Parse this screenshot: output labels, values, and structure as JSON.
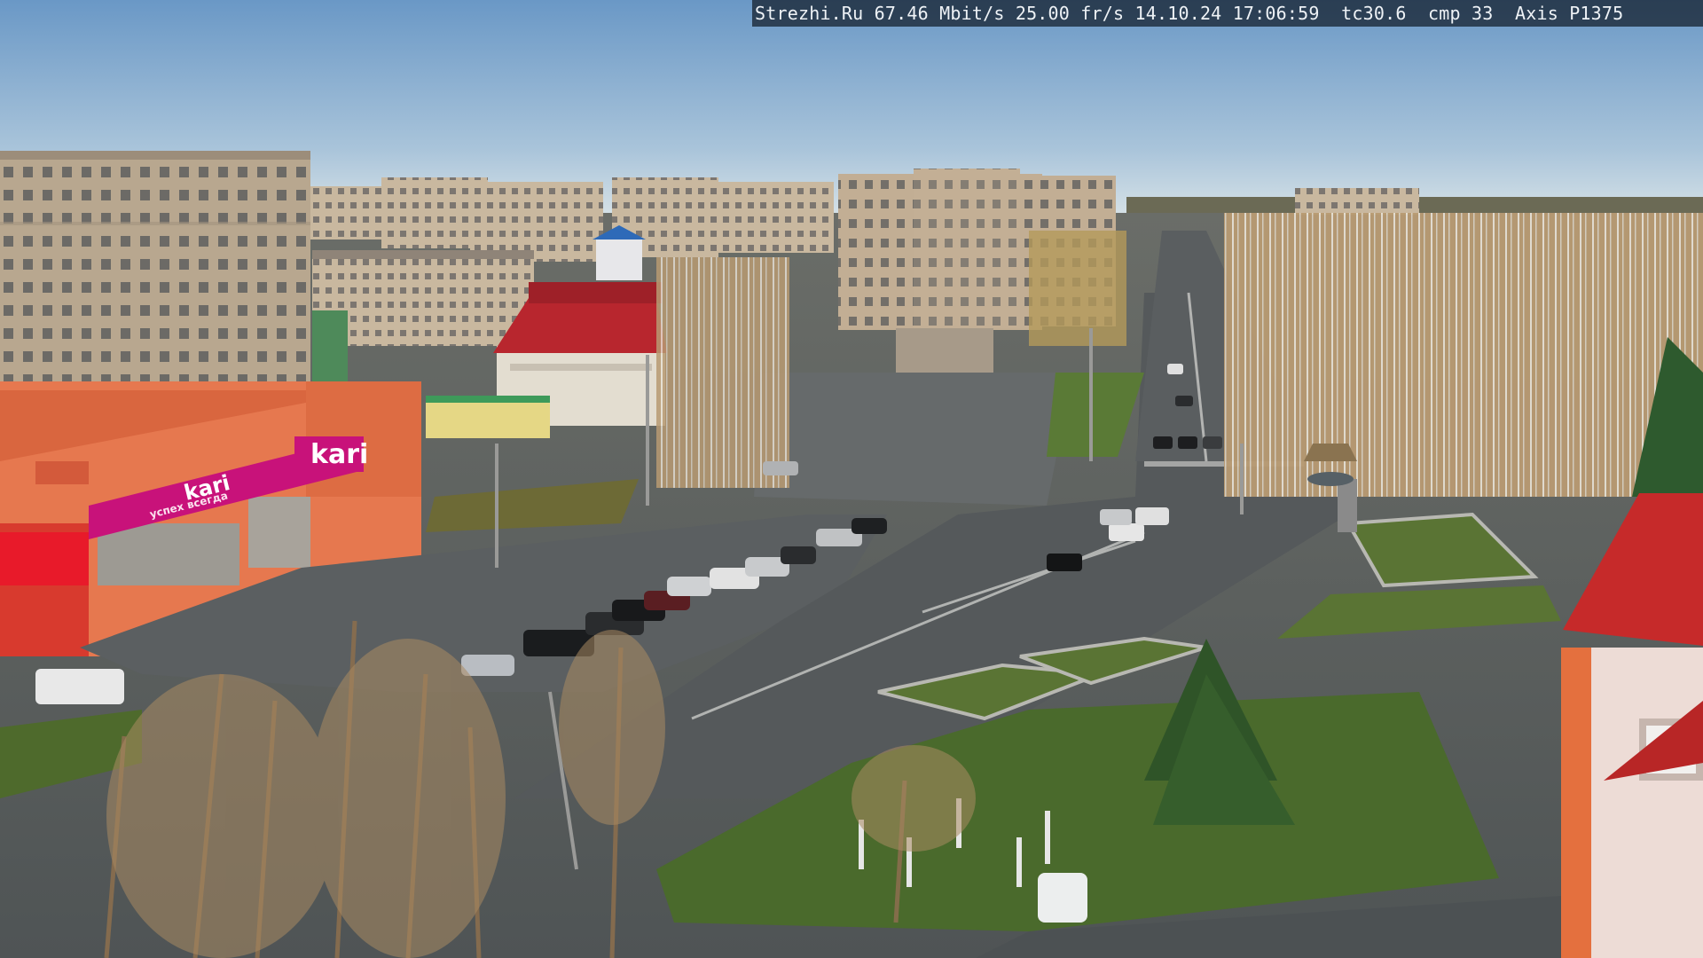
{
  "camera_overlay": {
    "site": "Strezhi.Ru",
    "bitrate": "67.46 Mbit/s",
    "framerate": "25.00 fr/s",
    "date": "14.10.24",
    "time": "17:06:59",
    "tc": "tc30.6",
    "cmp": "cmp 33",
    "camera_model": "Axis P1375"
  },
  "store_signs": {
    "brand": "kari",
    "banner_brand": "kari",
    "banner_tagline": "успех всегда"
  },
  "colors": {
    "sky_top": "#6f9cc9",
    "sky_bottom": "#c9dbe6",
    "asphalt": "#5d6266",
    "store_orange": "#e6784f",
    "store_magenta": "#c8127a",
    "roof_red": "#b8262e",
    "grass": "#4e6a2c"
  },
  "icons": [
    "webcam-timestamp-overlay"
  ]
}
